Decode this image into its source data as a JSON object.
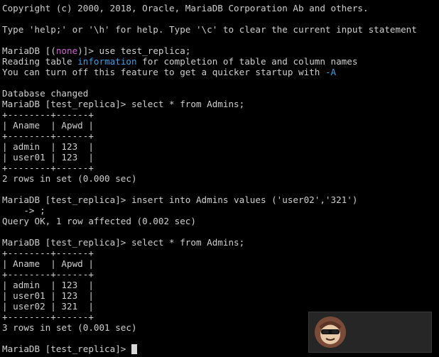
{
  "terminal": {
    "lines": [
      "Copyright (c) 2000, 2018, Oracle, MariaDB Corporation Ab and others.",
      "",
      "Type 'help;' or '\\h' for help. Type '\\c' to clear the current input statement",
      "",
      {
        "parts": [
          "MariaDB [(",
          "none",
          ")]> use test_replica;"
        ],
        "highlight": "magenta"
      },
      {
        "parts": [
          "Reading table ",
          "information",
          " for completion of table and column names"
        ],
        "highlight": "blue"
      },
      {
        "parts": [
          "You can turn off this feature to get a quicker startup with ",
          "-A",
          ""
        ],
        "highlight": "blue"
      },
      "",
      "Database changed",
      "MariaDB [test_replica]> select * from Admins;",
      "+--------+------+",
      "| Aname  | Apwd |",
      "+--------+------+",
      "| admin  | 123  |",
      "| user01 | 123  |",
      "+--------+------+",
      "2 rows in set (0.000 sec)",
      "",
      "MariaDB [test_replica]> insert into Admins values ('user02','321')",
      "    -> ;",
      "Query OK, 1 row affected (0.002 sec)",
      "",
      "MariaDB [test_replica]> select * from Admins;",
      "+--------+------+",
      "| Aname  | Apwd |",
      "+--------+------+",
      "| admin  | 123  |",
      "| user01 | 123  |",
      "| user02 | 321  |",
      "+--------+------+",
      "3 rows in set (0.001 sec)",
      ""
    ],
    "prompt": "MariaDB [test_replica]> "
  },
  "colors": {
    "background": "#000000",
    "text": "#cfcfcf",
    "magenta": "#d75fd7",
    "blue": "#3aa0e8",
    "cursor": "#d8d8d8"
  },
  "icons": {
    "watermark": "avatar-sunglasses-icon"
  }
}
